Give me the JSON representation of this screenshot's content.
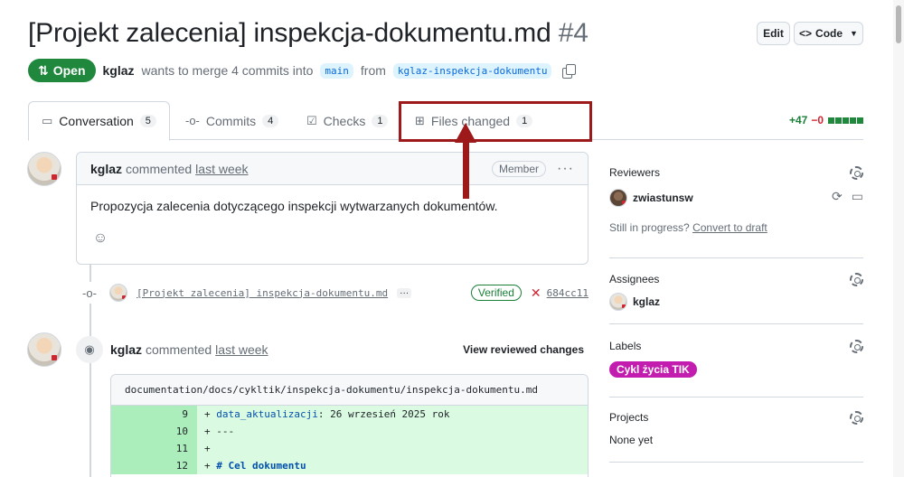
{
  "pr": {
    "title": "[Projekt zalecenia] inspekcja-dokumentu.md",
    "number": "#4",
    "state": "Open",
    "author": "kglaz",
    "merge_text": "wants to merge 4 commits into",
    "base_branch": "main",
    "from_text": "from",
    "head_branch": "kglaz-inspekcja-dokumentu"
  },
  "header": {
    "edit_label": "Edit",
    "code_label": "Code"
  },
  "tabs": [
    {
      "label": "Conversation",
      "count": "5"
    },
    {
      "label": "Commits",
      "count": "4"
    },
    {
      "label": "Checks",
      "count": "1"
    },
    {
      "label": "Files changed",
      "count": "1"
    }
  ],
  "diffstat": {
    "additions": "+47",
    "deletions": "−0"
  },
  "comment": {
    "author": "kglaz",
    "action": "commented",
    "time": "last week",
    "role": "Member",
    "body": "Propozycja zalecenia dotyczącego inspekcji wytwarzanych dokumentów."
  },
  "commit": {
    "message": "[Projekt zalecenia] inspekcja-dokumentu.md",
    "more": "···",
    "verified": "Verified",
    "sha": "684cc11"
  },
  "review": {
    "author": "kglaz",
    "action": "commented",
    "time": "last week",
    "view_changes": "View reviewed changes"
  },
  "file": {
    "path": "documentation/docs/cykltik/inspekcja-dokumentu/inspekcja-dokumentu.md",
    "lines": [
      {
        "num": "9",
        "sign": "+ ",
        "key": "data_aktualizacji",
        "rest": ": 26 wrzesień 2025 rok"
      },
      {
        "num": "10",
        "sign": "+ ",
        "key": "",
        "rest": "---"
      },
      {
        "num": "11",
        "sign": "+",
        "key": "",
        "rest": ""
      },
      {
        "num": "12",
        "sign": "+ ",
        "key": "# Cel dokumentu",
        "rest": ""
      }
    ]
  },
  "sidebar": {
    "reviewers_title": "Reviewers",
    "reviewer": "zwiastunsw",
    "progress_text": "Still in progress?",
    "convert_link": "Convert to draft",
    "assignees_title": "Assignees",
    "assignee": "kglaz",
    "labels_title": "Labels",
    "label": "Cykl życia TIK",
    "projects_title": "Projects",
    "projects_value": "None yet"
  },
  "colors": {
    "open": "#1f883d",
    "label": "#c21dae",
    "annotation": "#9e1a1a"
  }
}
